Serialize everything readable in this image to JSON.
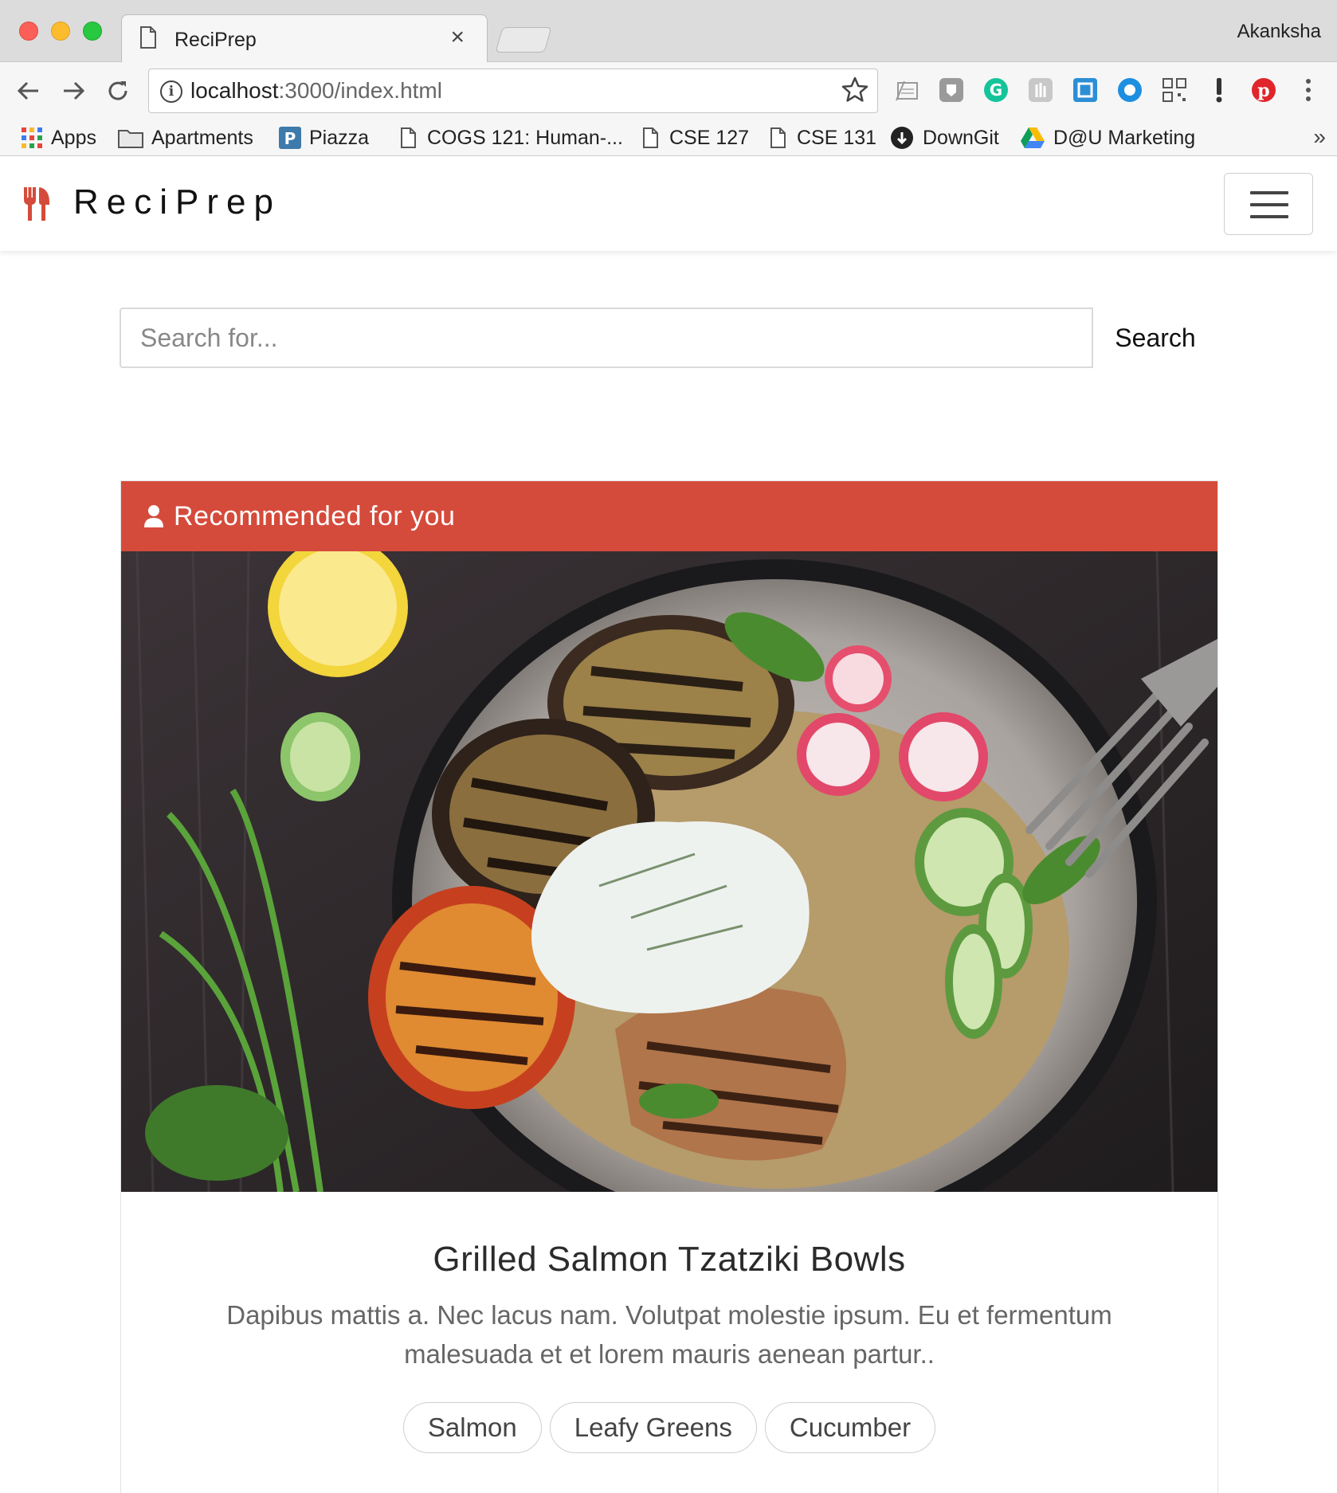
{
  "browser": {
    "tab_title": "ReciPrep",
    "tab_close": "×",
    "profile_name": "Akanksha",
    "url_host": "localhost",
    "url_rest": ":3000/index.html",
    "bookmarks": [
      {
        "label": "Apps",
        "icon": "apps-grid-icon"
      },
      {
        "label": "Apartments",
        "icon": "folder-icon"
      },
      {
        "label": "Piazza",
        "icon": "piazza-icon"
      },
      {
        "label": "COGS 121: Human-...",
        "icon": "page-icon"
      },
      {
        "label": "CSE 127",
        "icon": "page-icon"
      },
      {
        "label": "CSE 131",
        "icon": "page-icon"
      },
      {
        "label": "DownGit",
        "icon": "github-icon"
      },
      {
        "label": "D@U Marketing",
        "icon": "google-drive-icon"
      }
    ],
    "bookmarks_more": "»"
  },
  "navbar": {
    "brand": "ReciPrep",
    "brand_icon": "fork-knife-icon",
    "menu_icon": "hamburger-icon"
  },
  "search": {
    "placeholder": "Search for...",
    "button_label": "Search"
  },
  "card": {
    "header_icon": "user-icon",
    "header_title": "Recommended for you",
    "accent_color": "#d54b3b",
    "recipe_title": "Grilled Salmon Tzatziki Bowls",
    "description": "Dapibus mattis a. Nec lacus nam. Volutpat molestie ipsum. Eu et fermentum malesuada et et lorem mauris aenean partur..",
    "tags": [
      "Salmon",
      "Leafy Greens",
      "Cucumber"
    ]
  }
}
